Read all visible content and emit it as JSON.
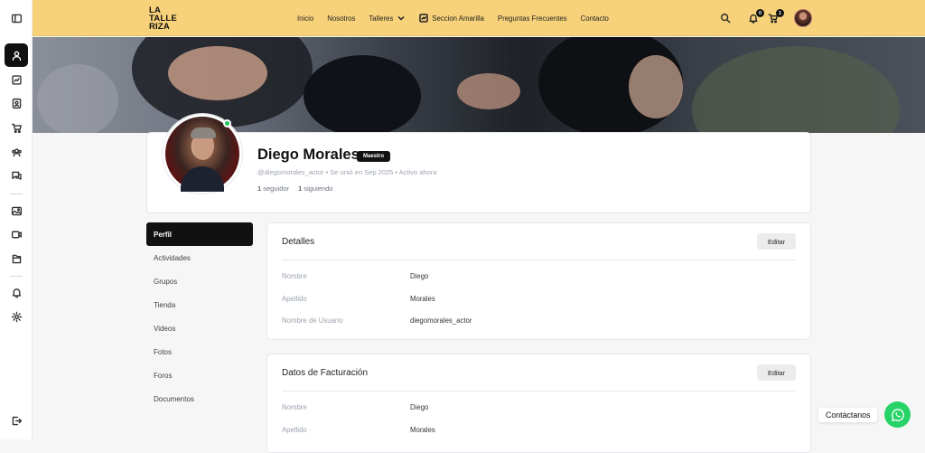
{
  "brand": {
    "logo_lines": [
      "LA",
      "TALLE",
      "RIZA"
    ]
  },
  "nav": {
    "items": [
      "Inicio",
      "Nosotros",
      "Talleres",
      "Seccion Amarilla",
      "Preguntas Frecuentes",
      "Contacto"
    ]
  },
  "header": {
    "notifications_count": "0",
    "cart_count": "1"
  },
  "sidebar": {
    "icons": [
      "panel-toggle-icon",
      "profile-icon",
      "activity-icon",
      "members-icon",
      "cart-icon",
      "groups-icon",
      "forums-icon",
      "photos-icon",
      "videos-icon",
      "documents-icon",
      "bell-icon",
      "settings-icon",
      "logout-icon"
    ]
  },
  "profile": {
    "name": "Diego Morales",
    "role": "Maestro",
    "meta": "@diegomorales_actor • Se unió en Sep 2025 • Activo ahora",
    "followers_count": "1",
    "followers_label": "seguidor",
    "following_count": "1",
    "following_label": "siguiendo"
  },
  "tabs": [
    "Perfil",
    "Actividades",
    "Grupos",
    "Tienda",
    "Videos",
    "Fotos",
    "Foros",
    "Documentos"
  ],
  "details": {
    "title": "Detalles",
    "edit_label": "Editar",
    "rows": [
      {
        "label": "Nombre",
        "value": "Diego"
      },
      {
        "label": "Apellido",
        "value": "Morales"
      },
      {
        "label": "Nombre de Usuario",
        "value": "diegomorales_actor"
      }
    ]
  },
  "billing": {
    "title": "Datos de Facturación",
    "edit_label": "Editar",
    "rows": [
      {
        "label": "Nombre",
        "value": "Diego"
      },
      {
        "label": "Apellido",
        "value": "Morales"
      }
    ]
  },
  "contact": {
    "label": "Contáctanos"
  },
  "colors": {
    "header": "#f8d27a",
    "accent": "#111111",
    "whatsapp": "#25d366",
    "online": "#22c55e"
  }
}
